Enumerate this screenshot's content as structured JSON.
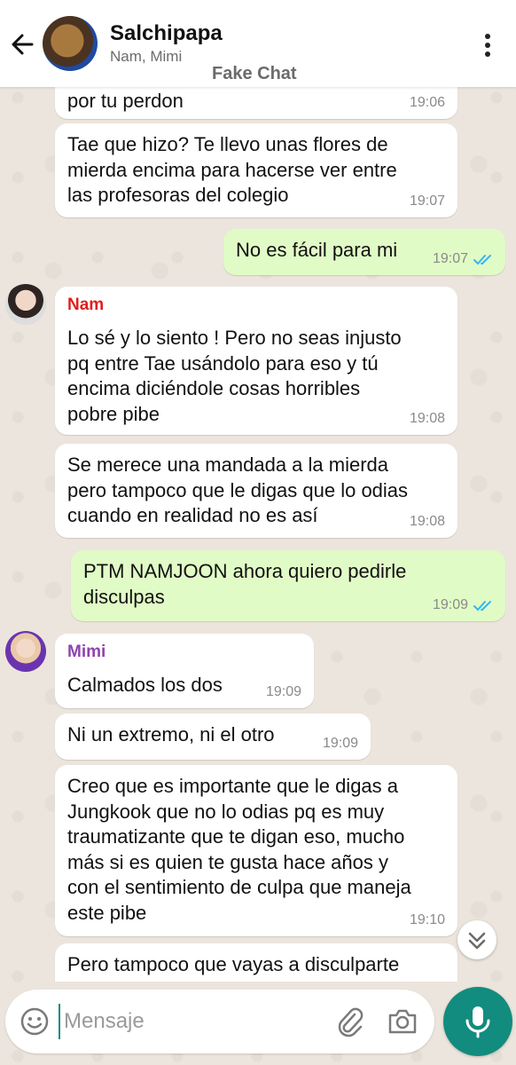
{
  "header": {
    "title": "Salchipapa",
    "subtitle": "Nam, Mimi",
    "watermark": "Fake Chat"
  },
  "messages": [
    {
      "text": "por tu perdon",
      "time": "19:06"
    },
    {
      "text": "Tae que hizo? Te llevo unas flores de\nmierda encima para hacerse ver entre\nlas profesoras del colegio",
      "time": "19:07"
    },
    {
      "text": "No es fácil para mi",
      "time": "19:07",
      "status": "read"
    },
    {
      "sender": "Nam",
      "text": "Lo sé y lo siento ! Pero no seas injusto\npq entre Tae usándolo para eso y tú\nencima diciéndole cosas horribles\npobre pibe",
      "time": "19:08"
    },
    {
      "text": "Se merece una mandada a la mierda\npero tampoco que le digas que lo odias\ncuando en realidad no es así",
      "time": "19:08"
    },
    {
      "text": "PTM NAMJOON ahora quiero pedirle\ndisculpas",
      "time": "19:09",
      "status": "read"
    },
    {
      "sender": "Mimi",
      "text": "Calmados los dos",
      "time": "19:09"
    },
    {
      "text": "Ni un extremo, ni el otro",
      "time": "19:09"
    },
    {
      "text": "Creo que es importante que le digas a\nJungkook que no lo odias pq es muy\ntraumatizante que te digan eso, mucho\nmás si es quien te gusta hace años y\ncon el sentimiento de culpa que maneja\neste pibe",
      "time": "19:10"
    },
    {
      "text": "Pero tampoco que vayas a disculparte"
    }
  ],
  "senders": {
    "nam_color": "#e01e1e",
    "mimi_color": "#8e44ad"
  },
  "input": {
    "placeholder": "Mensaje",
    "value": ""
  },
  "colors": {
    "accent": "#128c7e",
    "outgoing": "#e1fbc6",
    "tick": "#34b7f1"
  },
  "icons": [
    "back-arrow-icon",
    "more-vert-icon",
    "double-check-icon",
    "chevron-double-down-icon",
    "emoji-icon",
    "attach-icon",
    "camera-icon",
    "mic-icon"
  ]
}
